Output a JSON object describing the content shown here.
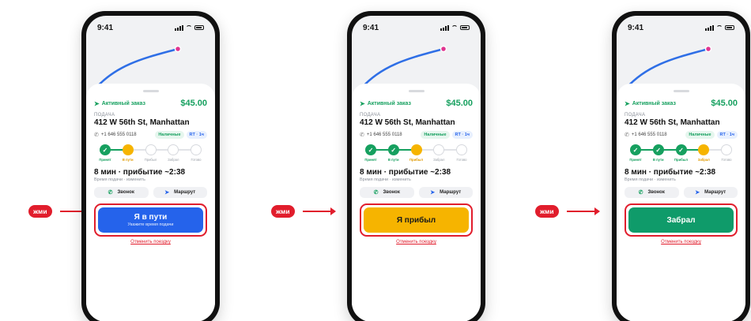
{
  "colors": {
    "accent_green": "#16a05f",
    "accent_blue": "#2563eb",
    "warning_yellow": "#f6b400",
    "alert_red": "#e11d2c"
  },
  "press_label": "жми",
  "screens": [
    {
      "time": "9:41",
      "active_order": "Активный заказ",
      "price": "$45.00",
      "pickup_label": "ПОДАЧА",
      "address": "412 W 56th St, Manhattan",
      "phone": "+1 646 555 0118",
      "cash_pill": "Наличные",
      "time_pill": "RT · 1ч",
      "steps": [
        "Принят",
        "В пути",
        "Прибыл",
        "Забрал",
        "Готово"
      ],
      "eta": "8 мин · прибытие ~2:38",
      "eta_sub": "Время подачи · изменить",
      "call_label": "Звонок",
      "route_label": "Маршрут",
      "cta_title": "Я в пути",
      "cta_sub": "Укажите время подачи",
      "cancel_label": "Отменить поездку"
    },
    {
      "time": "9:41",
      "active_order": "Активный заказ",
      "price": "$45.00",
      "pickup_label": "ПОДАЧА",
      "address": "412 W 56th St, Manhattan",
      "phone": "+1 646 555 0118",
      "cash_pill": "Наличные",
      "time_pill": "RT · 1ч",
      "steps": [
        "Принят",
        "В пути",
        "Прибыл",
        "Забрал",
        "Готово"
      ],
      "eta": "8 мин · прибытие ~2:38",
      "eta_sub": "Время подачи · изменить",
      "call_label": "Звонок",
      "route_label": "Маршрут",
      "cta_title": "Я прибыл",
      "cancel_label": "Отменить поездку"
    },
    {
      "time": "9:41",
      "active_order": "Активный заказ",
      "price": "$45.00",
      "pickup_label": "ПОДАЧА",
      "address": "412 W 56th St, Manhattan",
      "phone": "+1 646 555 0118",
      "cash_pill": "Наличные",
      "time_pill": "RT · 1ч",
      "steps": [
        "Принят",
        "В пути",
        "Прибыл",
        "Забрал",
        "Готово"
      ],
      "eta": "8 мин · прибытие ~2:38",
      "eta_sub": "Время подачи · изменить",
      "call_label": "Звонок",
      "route_label": "Маршрут",
      "cta_title": "Забрал",
      "cancel_label": "Отменить поездку"
    }
  ]
}
